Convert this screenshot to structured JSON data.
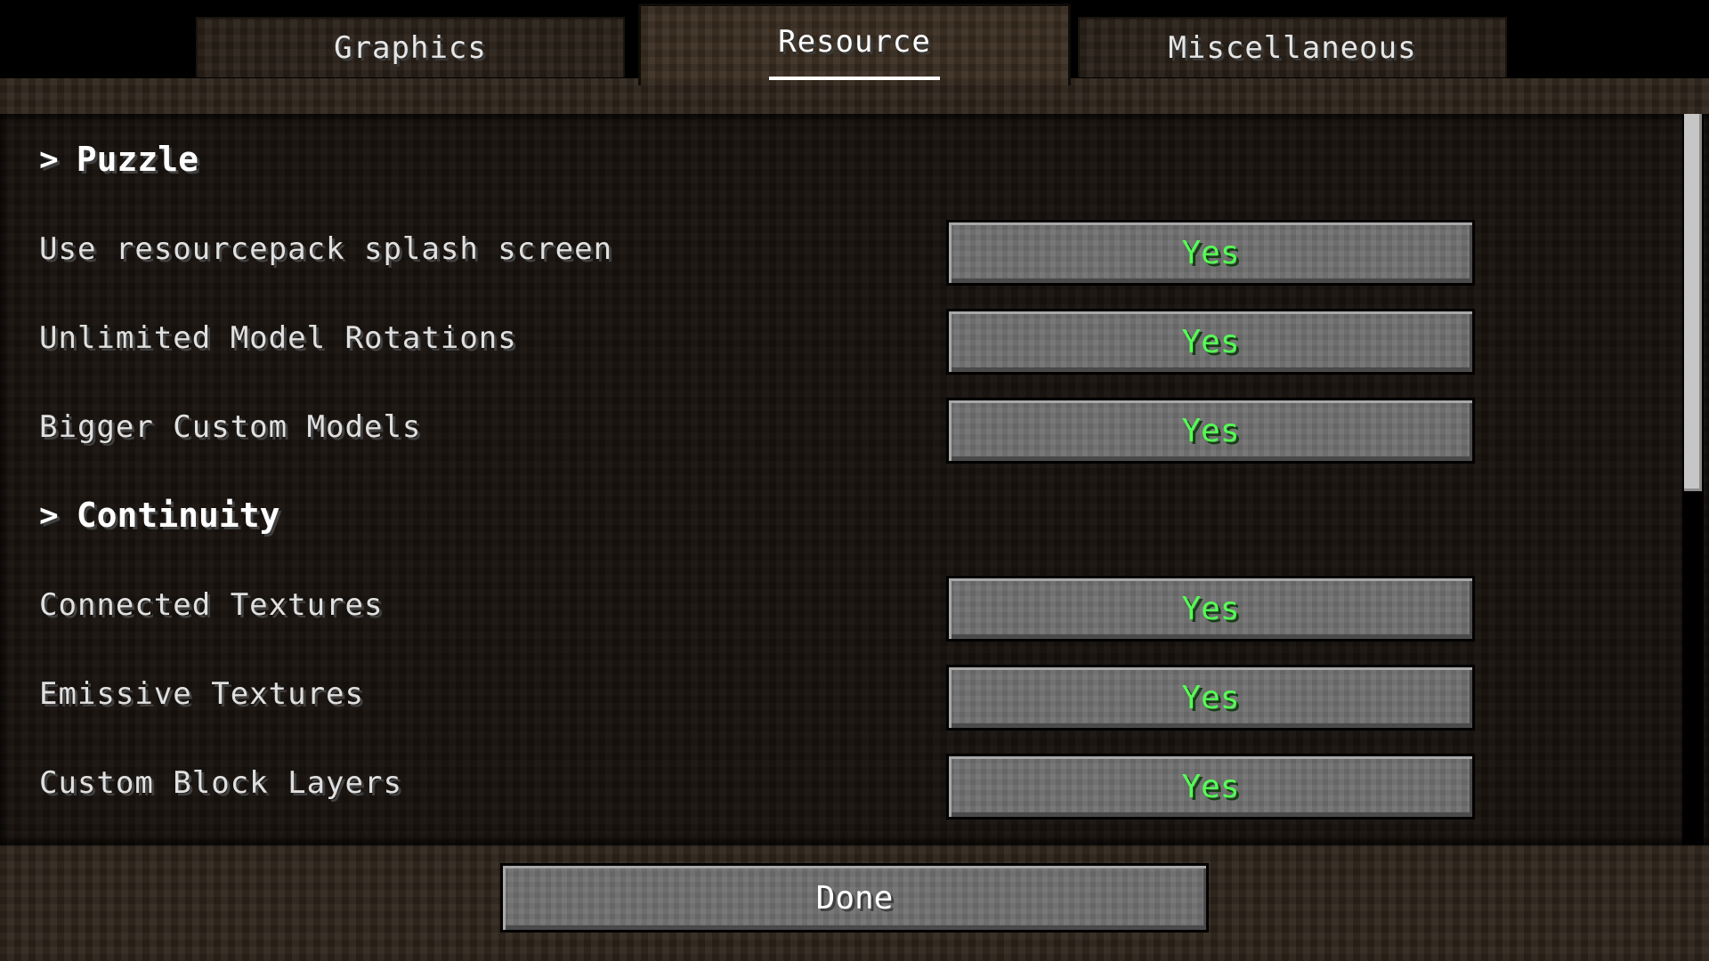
{
  "tabs": [
    {
      "label": "Graphics",
      "active": false
    },
    {
      "label": "Resource",
      "active": true
    },
    {
      "label": "Miscellaneous",
      "active": false
    }
  ],
  "sections": {
    "puzzle": {
      "title": "Puzzle",
      "options": [
        {
          "label": "Use resourcepack splash screen",
          "value": "Yes"
        },
        {
          "label": "Unlimited Model Rotations",
          "value": "Yes"
        },
        {
          "label": "Bigger Custom Models",
          "value": "Yes"
        }
      ]
    },
    "continuity": {
      "title": "Continuity",
      "options": [
        {
          "label": "Connected Textures",
          "value": "Yes"
        },
        {
          "label": "Emissive Textures",
          "value": "Yes"
        },
        {
          "label": "Custom Block Layers",
          "value": "Yes"
        }
      ]
    }
  },
  "footer": {
    "done_label": "Done"
  },
  "icons": {
    "expand": "chevron-right-icon"
  },
  "colors": {
    "value_on": "#55ff55",
    "text": "#e0e0e0"
  }
}
